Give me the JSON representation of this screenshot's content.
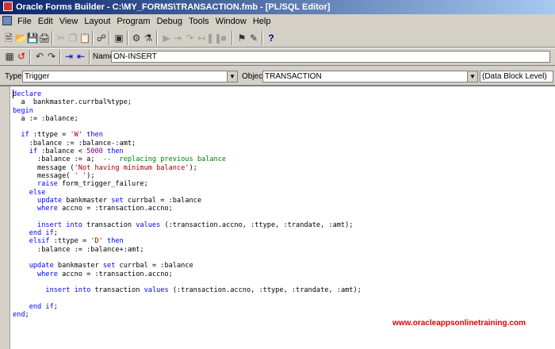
{
  "window": {
    "title": "Oracle Forms Builder - C:\\MY_FORMS\\TRANSACTION.fmb - [PL/SQL Editor]"
  },
  "menu": [
    "File",
    "Edit",
    "View",
    "Layout",
    "Program",
    "Debug",
    "Tools",
    "Window",
    "Help"
  ],
  "toolbar": {
    "icons": [
      "new-icon",
      "open-icon",
      "save-icon",
      "print-icon",
      "cut-icon",
      "copy-icon",
      "paste-icon",
      "connect-icon",
      "run-form-icon",
      "compile-icon",
      "compile-all-icon",
      "debug-run-icon",
      "step-into-icon",
      "step-over-icon",
      "step-out-icon",
      "pause-icon",
      "stop-icon",
      "object-navigator-icon",
      "property-palette-icon",
      "help-icon"
    ],
    "help_label": "?"
  },
  "editor_toolbar": {
    "name_label": "Name:",
    "name_value": "ON-INSERT"
  },
  "type_bar": {
    "type_label": "Type:",
    "type_value": "Trigger",
    "object_label": "Object:",
    "object_value": "TRANSACTION",
    "level_value": "(Data Block Level)"
  },
  "code_lines": [
    [
      [
        "kw",
        "declare"
      ]
    ],
    [
      [
        "",
        "  a  bankmaster.currbal%type;"
      ]
    ],
    [
      [
        "kw",
        "begin"
      ]
    ],
    [
      [
        "",
        "  a := :balance;"
      ]
    ],
    [
      [
        "",
        ""
      ]
    ],
    [
      [
        "",
        "  "
      ],
      [
        "kw",
        "if"
      ],
      [
        "",
        " :ttype = "
      ],
      [
        "str",
        "'W'"
      ],
      [
        "",
        ""
      ],
      [
        "kw",
        " then"
      ]
    ],
    [
      [
        "",
        "    :balance := :balance-:amt;"
      ]
    ],
    [
      [
        "",
        "    "
      ],
      [
        "kw",
        "if"
      ],
      [
        "",
        " :balance < "
      ],
      [
        "num",
        "5000"
      ],
      [
        "kw",
        " then"
      ]
    ],
    [
      [
        "",
        "      :balance := a;  "
      ],
      [
        "cmt",
        "--  replacing previous balance"
      ]
    ],
    [
      [
        "",
        "      message ("
      ],
      [
        "str",
        "'Not having minimum balance'"
      ],
      [
        "",
        ");"
      ]
    ],
    [
      [
        "",
        "      message( "
      ],
      [
        "str",
        "' '"
      ],
      [
        "",
        ");"
      ]
    ],
    [
      [
        "",
        "      "
      ],
      [
        "kw",
        "raise"
      ],
      [
        "",
        " form_trigger_failure;"
      ]
    ],
    [
      [
        "",
        "    "
      ],
      [
        "kw",
        "else"
      ]
    ],
    [
      [
        "",
        "      "
      ],
      [
        "kw",
        "update"
      ],
      [
        "",
        " bankmaster "
      ],
      [
        "kw",
        "set"
      ],
      [
        "",
        " currbal = :balance"
      ]
    ],
    [
      [
        "",
        "      "
      ],
      [
        "kw",
        "where"
      ],
      [
        "",
        " accno = :transaction.accno;"
      ]
    ],
    [
      [
        "",
        ""
      ]
    ],
    [
      [
        "",
        "      "
      ],
      [
        "kw",
        "insert into"
      ],
      [
        "",
        " transaction "
      ],
      [
        "kw",
        "values"
      ],
      [
        "",
        " (:transaction.accno, :ttype, :trandate, :amt);"
      ]
    ],
    [
      [
        "",
        "    "
      ],
      [
        "kw",
        "end if"
      ],
      [
        "",
        ";"
      ]
    ],
    [
      [
        "",
        "    "
      ],
      [
        "kw",
        "elsif"
      ],
      [
        "",
        " :ttype = "
      ],
      [
        "str",
        "'D'"
      ],
      [
        "kw",
        " then"
      ]
    ],
    [
      [
        "",
        "      :balance := :balance+:amt;"
      ]
    ],
    [
      [
        "",
        ""
      ]
    ],
    [
      [
        "",
        "    "
      ],
      [
        "kw",
        "update"
      ],
      [
        "",
        " bankmaster "
      ],
      [
        "kw",
        "set"
      ],
      [
        "",
        " currbal = :balance"
      ]
    ],
    [
      [
        "",
        "      "
      ],
      [
        "kw",
        "where"
      ],
      [
        "",
        " accno = :transaction.accno;"
      ]
    ],
    [
      [
        "",
        ""
      ]
    ],
    [
      [
        "",
        "        "
      ],
      [
        "kw",
        "insert into"
      ],
      [
        "",
        " transaction "
      ],
      [
        "kw",
        "values"
      ],
      [
        "",
        " (:transaction.accno, :ttype, :trandate, :amt);"
      ]
    ],
    [
      [
        "",
        ""
      ]
    ],
    [
      [
        "",
        "    "
      ],
      [
        "kw",
        "end if"
      ],
      [
        "",
        ";"
      ]
    ],
    [
      [
        "kw",
        "end"
      ],
      [
        "",
        ";"
      ]
    ]
  ],
  "watermark": "www.oracleappsonlinetraining.com",
  "colors": {
    "keyword": "#0000ff",
    "string": "#a00000",
    "comment": "#008000",
    "number": "#800080",
    "watermark": "#e00000"
  }
}
